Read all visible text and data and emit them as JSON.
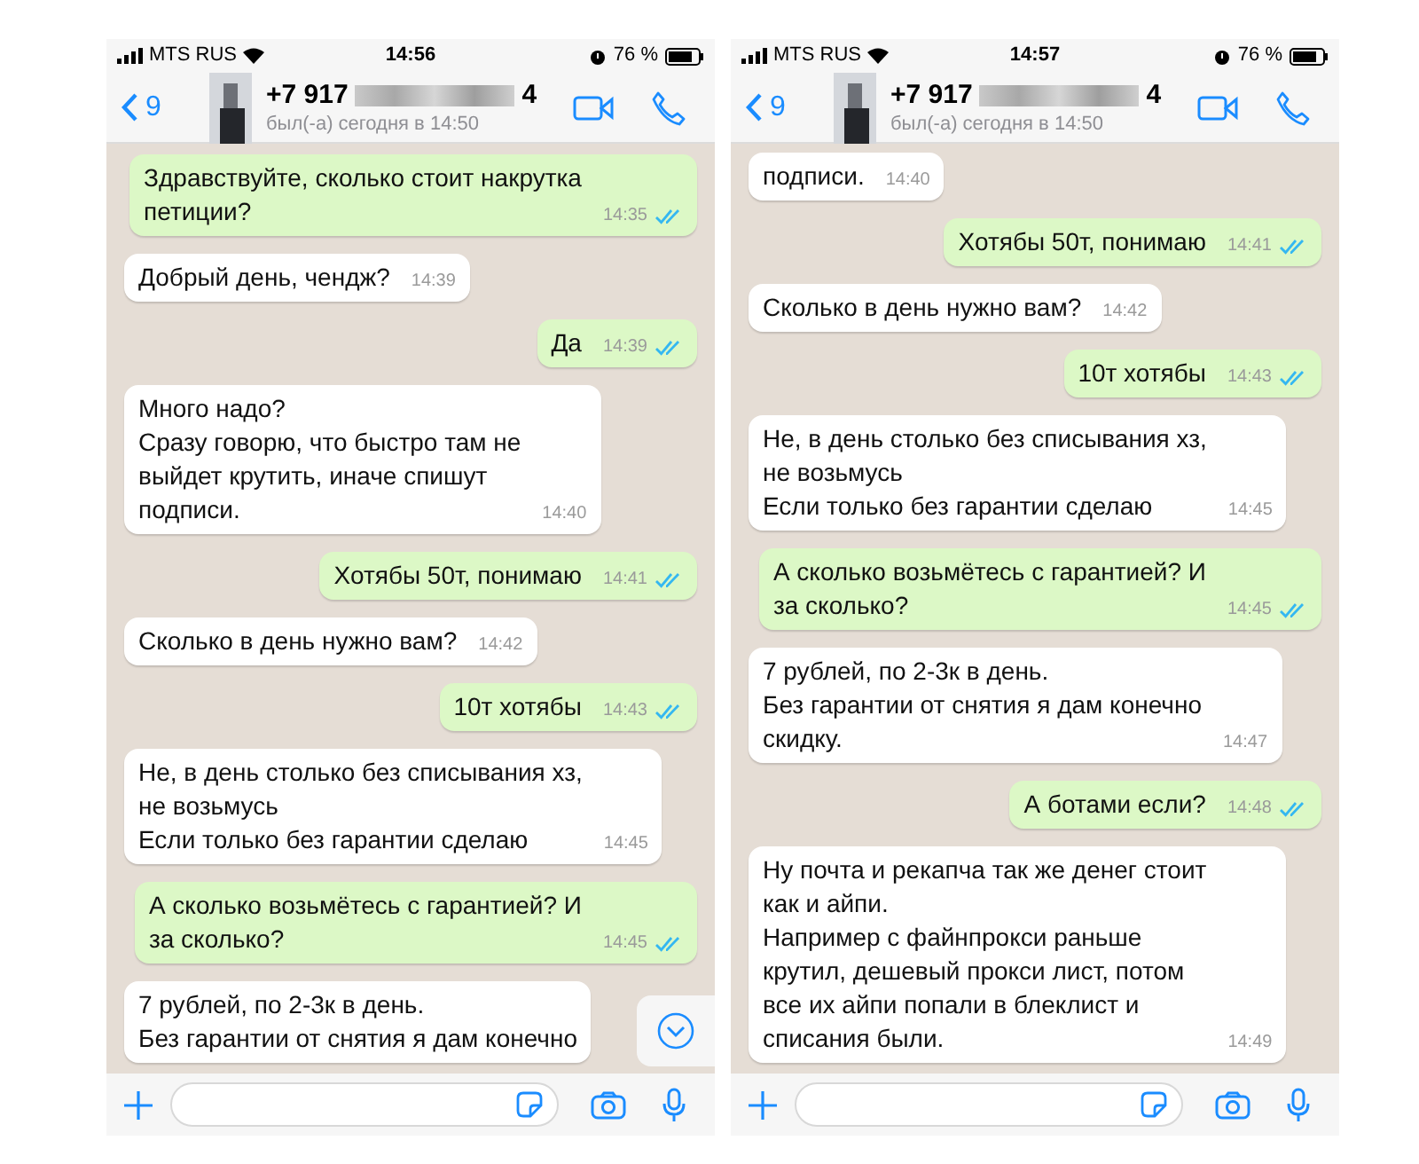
{
  "phones": [
    {
      "status_bar": {
        "carrier": "MTS RUS",
        "time": "14:56",
        "battery": "76 %"
      },
      "header": {
        "back_count": "9",
        "number_start": "+7 917",
        "number_end": "4",
        "last_seen": "был(-а) сегодня в 14:50"
      },
      "show_scroll_down": true,
      "messages": [
        {
          "kind": "out",
          "text": "Здравствуйте, сколько стоит накрутка\nпетиции?",
          "time": "14:35",
          "read": true
        },
        {
          "kind": "in",
          "text": "Добрый день, чендж?",
          "time": "14:39"
        },
        {
          "kind": "out",
          "text": "Да",
          "time": "14:39",
          "read": true
        },
        {
          "kind": "in",
          "text": "Много надо?\nСразу говорю, что быстро там не\nвыйдет крутить, иначе спишут\nподписи.",
          "time": "14:40"
        },
        {
          "kind": "out",
          "text": "Хотябы 50т, понимаю",
          "time": "14:41",
          "read": true
        },
        {
          "kind": "in",
          "text": "Сколько в день нужно вам?",
          "time": "14:42"
        },
        {
          "kind": "out",
          "text": "10т хотябы",
          "time": "14:43",
          "read": true
        },
        {
          "kind": "in",
          "text": "Не, в день столько без списывания хз,\nне возьмусь\nЕсли только без гарантии сделаю",
          "time": "14:45"
        },
        {
          "kind": "out",
          "text": "А сколько возьмётесь с гарантией? И\nза сколько?",
          "time": "14:45",
          "read": true
        },
        {
          "kind": "in",
          "text": "7 рублей, по 2-3к в день.\nБез гарантии от снятия я дам конечно"
        }
      ]
    },
    {
      "status_bar": {
        "carrier": "MTS RUS",
        "time": "14:57",
        "battery": "76 %"
      },
      "header": {
        "back_count": "9",
        "number_start": "+7 917",
        "number_end": "4",
        "last_seen": "был(-а) сегодня в 14:50"
      },
      "show_scroll_down": false,
      "messages": [
        {
          "kind": "in",
          "text": "подписи.",
          "time": "14:40"
        },
        {
          "kind": "out",
          "text": "Хотябы 50т, понимаю",
          "time": "14:41",
          "read": true
        },
        {
          "kind": "in",
          "text": "Сколько в день нужно вам?",
          "time": "14:42"
        },
        {
          "kind": "out",
          "text": "10т хотябы",
          "time": "14:43",
          "read": true
        },
        {
          "kind": "in",
          "text": "Не, в день столько без списывания хз,\nне возьмусь\nЕсли только без гарантии сделаю",
          "time": "14:45"
        },
        {
          "kind": "out",
          "text": "А сколько возьмётесь с гарантией? И\nза сколько?",
          "time": "14:45",
          "read": true
        },
        {
          "kind": "in",
          "text": "7 рублей, по 2-3к в день.\nБез гарантии от снятия я дам конечно\nскидку.",
          "time": "14:47"
        },
        {
          "kind": "out",
          "text": "А ботами если?",
          "time": "14:48",
          "read": true
        },
        {
          "kind": "in",
          "text": "Ну почта и рекапча так же денег стоит\nкак и айпи.\nНапример с файнпрокси раньше\nкрутил, дешевый прокси лист, потом\nвсе их айпи попали в блеклист и\nсписания были.",
          "time": "14:49"
        }
      ]
    }
  ]
}
